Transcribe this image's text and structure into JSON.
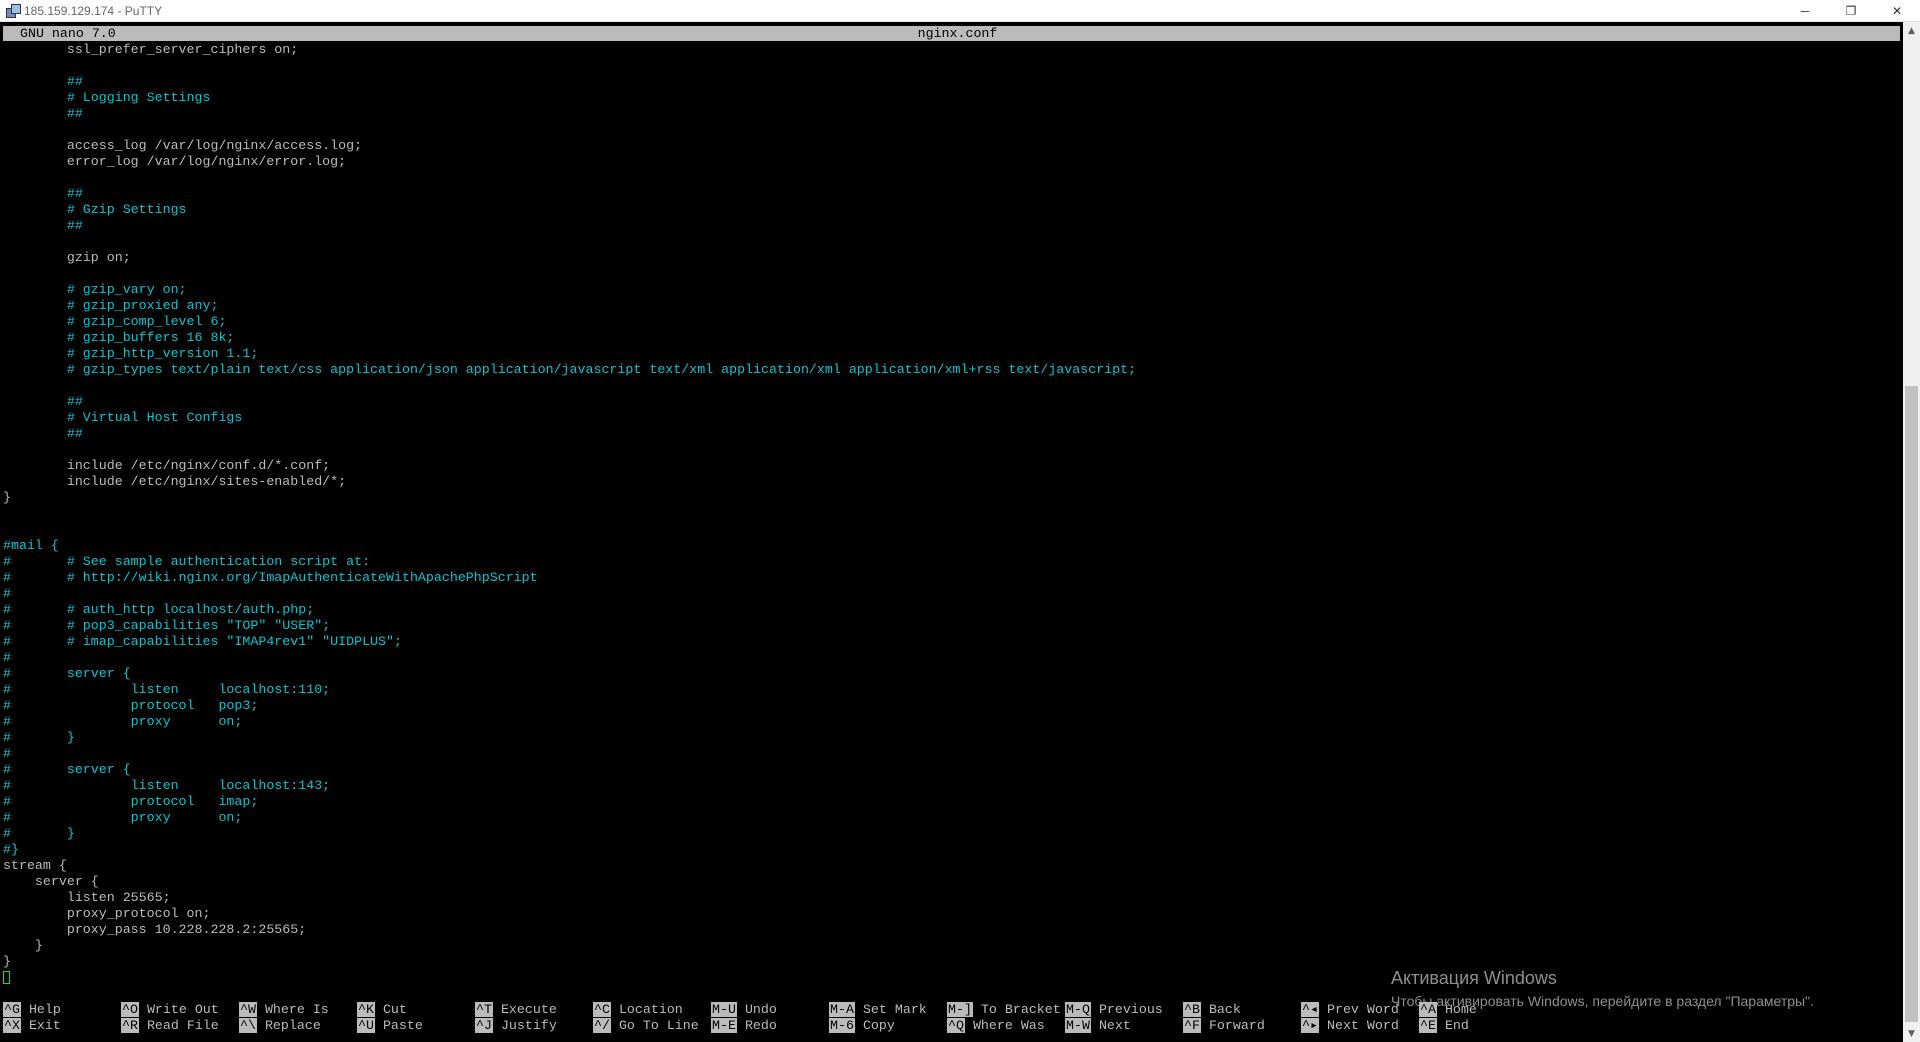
{
  "window": {
    "title": "185.159.129.174 - PuTTY",
    "minimize": "─",
    "restore": "❐",
    "close": "✕"
  },
  "nano": {
    "version": "GNU nano 7.0",
    "filename": "nginx.conf"
  },
  "code_lines": [
    [
      {
        "t": "        ssl_prefer_server_ciphers on;",
        "c": "n"
      }
    ],
    [
      {
        "t": "",
        "c": "n"
      }
    ],
    [
      {
        "t": "        ##",
        "c": "c"
      }
    ],
    [
      {
        "t": "        # Logging Settings",
        "c": "c"
      }
    ],
    [
      {
        "t": "        ##",
        "c": "c"
      }
    ],
    [
      {
        "t": "",
        "c": "n"
      }
    ],
    [
      {
        "t": "        access_log /var/log/nginx/access.log;",
        "c": "n"
      }
    ],
    [
      {
        "t": "        error_log /var/log/nginx/error.log;",
        "c": "n"
      }
    ],
    [
      {
        "t": "",
        "c": "n"
      }
    ],
    [
      {
        "t": "        ##",
        "c": "c"
      }
    ],
    [
      {
        "t": "        # Gzip Settings",
        "c": "c"
      }
    ],
    [
      {
        "t": "        ##",
        "c": "c"
      }
    ],
    [
      {
        "t": "",
        "c": "n"
      }
    ],
    [
      {
        "t": "        gzip on;",
        "c": "n"
      }
    ],
    [
      {
        "t": "",
        "c": "n"
      }
    ],
    [
      {
        "t": "        # gzip_vary on;",
        "c": "c"
      }
    ],
    [
      {
        "t": "        # gzip_proxied any;",
        "c": "c"
      }
    ],
    [
      {
        "t": "        # gzip_comp_level 6;",
        "c": "c"
      }
    ],
    [
      {
        "t": "        # gzip_buffers 16 8k;",
        "c": "c"
      }
    ],
    [
      {
        "t": "        # gzip_http_version 1.1;",
        "c": "c"
      }
    ],
    [
      {
        "t": "        # gzip_types text/plain text/css application/json application/javascript text/xml application/xml application/xml+rss text/javascript;",
        "c": "c"
      }
    ],
    [
      {
        "t": "",
        "c": "n"
      }
    ],
    [
      {
        "t": "        ##",
        "c": "c"
      }
    ],
    [
      {
        "t": "        # Virtual Host Configs",
        "c": "c"
      }
    ],
    [
      {
        "t": "        ##",
        "c": "c"
      }
    ],
    [
      {
        "t": "",
        "c": "n"
      }
    ],
    [
      {
        "t": "        include /etc/nginx/conf.d/*.conf;",
        "c": "n"
      }
    ],
    [
      {
        "t": "        include /etc/nginx/sites-enabled/*;",
        "c": "n"
      }
    ],
    [
      {
        "t": "}",
        "c": "n"
      }
    ],
    [
      {
        "t": "",
        "c": "n"
      }
    ],
    [
      {
        "t": "",
        "c": "n"
      }
    ],
    [
      {
        "t": "#mail {",
        "c": "c"
      }
    ],
    [
      {
        "t": "#       # See sample authentication script at:",
        "c": "c"
      }
    ],
    [
      {
        "t": "#       # http://wiki.nginx.org/ImapAuthenticateWithApachePhpScript",
        "c": "c"
      }
    ],
    [
      {
        "t": "#",
        "c": "c"
      }
    ],
    [
      {
        "t": "#       # auth_http localhost/auth.php;",
        "c": "c"
      }
    ],
    [
      {
        "t": "#       # pop3_capabilities \"TOP\" \"USER\";",
        "c": "c"
      }
    ],
    [
      {
        "t": "#       # imap_capabilities \"IMAP4rev1\" \"UIDPLUS\";",
        "c": "c"
      }
    ],
    [
      {
        "t": "#",
        "c": "c"
      }
    ],
    [
      {
        "t": "#       server {",
        "c": "c"
      }
    ],
    [
      {
        "t": "#               listen     localhost:110;",
        "c": "c"
      }
    ],
    [
      {
        "t": "#               protocol   pop3;",
        "c": "c"
      }
    ],
    [
      {
        "t": "#               proxy      on;",
        "c": "c"
      }
    ],
    [
      {
        "t": "#       }",
        "c": "c"
      }
    ],
    [
      {
        "t": "#",
        "c": "c"
      }
    ],
    [
      {
        "t": "#       server {",
        "c": "c"
      }
    ],
    [
      {
        "t": "#               listen     localhost:143;",
        "c": "c"
      }
    ],
    [
      {
        "t": "#               protocol   imap;",
        "c": "c"
      }
    ],
    [
      {
        "t": "#               proxy      on;",
        "c": "c"
      }
    ],
    [
      {
        "t": "#       }",
        "c": "c"
      }
    ],
    [
      {
        "t": "#}",
        "c": "c"
      }
    ],
    [
      {
        "t": "stream {",
        "c": "n"
      }
    ],
    [
      {
        "t": "    server {",
        "c": "n"
      }
    ],
    [
      {
        "t": "        listen 25565;",
        "c": "n"
      }
    ],
    [
      {
        "t": "        proxy_protocol on;",
        "c": "n"
      }
    ],
    [
      {
        "t": "        proxy_pass 10.228.228.2:25565;",
        "c": "n"
      }
    ],
    [
      {
        "t": "    }",
        "c": "n"
      }
    ],
    [
      {
        "t": "}",
        "c": "n"
      }
    ]
  ],
  "shortcuts": [
    [
      {
        "key": "^G",
        "label": "Help"
      },
      {
        "key": "^O",
        "label": "Write Out"
      },
      {
        "key": "^W",
        "label": "Where Is"
      },
      {
        "key": "^K",
        "label": "Cut"
      },
      {
        "key": "^T",
        "label": "Execute"
      },
      {
        "key": "^C",
        "label": "Location"
      },
      {
        "key": "M-U",
        "label": "Undo"
      },
      {
        "key": "M-A",
        "label": "Set Mark"
      },
      {
        "key": "M-]",
        "label": "To Bracket"
      },
      {
        "key": "M-Q",
        "label": "Previous"
      },
      {
        "key": "^B",
        "label": "Back"
      },
      {
        "key": "^◂",
        "label": "Prev Word"
      },
      {
        "key": "^A",
        "label": "Home"
      }
    ],
    [
      {
        "key": "^X",
        "label": "Exit"
      },
      {
        "key": "^R",
        "label": "Read File"
      },
      {
        "key": "^\\",
        "label": "Replace"
      },
      {
        "key": "^U",
        "label": "Paste"
      },
      {
        "key": "^J",
        "label": "Justify"
      },
      {
        "key": "^/",
        "label": "Go To Line"
      },
      {
        "key": "M-E",
        "label": "Redo"
      },
      {
        "key": "M-6",
        "label": "Copy"
      },
      {
        "key": "^Q",
        "label": "Where Was"
      },
      {
        "key": "M-W",
        "label": "Next"
      },
      {
        "key": "^F",
        "label": "Forward"
      },
      {
        "key": "^▸",
        "label": "Next Word"
      },
      {
        "key": "^E",
        "label": "End"
      }
    ]
  ],
  "activation": {
    "title": "Активация Windows",
    "subtitle": "Чтобы активировать Windows, перейдите в раздел \"Параметры\"."
  },
  "colors": {
    "comment": "#00c8d4",
    "text": "#bbbbbb",
    "cursor": "#19e619"
  }
}
